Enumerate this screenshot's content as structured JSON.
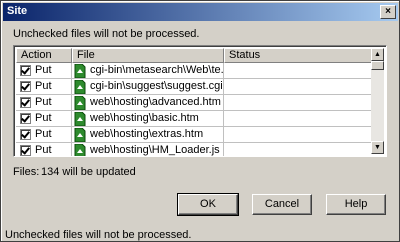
{
  "window": {
    "title": "Site",
    "close_label": "×"
  },
  "instruction": "Unchecked files will not be processed.",
  "list": {
    "columns": {
      "action": "Action",
      "file": "File",
      "status": "Status"
    },
    "rows": [
      {
        "action": "Put",
        "file": "cgi-bin\\metasearch\\Web\\te...",
        "status": ""
      },
      {
        "action": "Put",
        "file": "cgi-bin\\suggest\\suggest.cgi",
        "status": ""
      },
      {
        "action": "Put",
        "file": "web\\hosting\\advanced.htm",
        "status": ""
      },
      {
        "action": "Put",
        "file": "web\\hosting\\basic.htm",
        "status": ""
      },
      {
        "action": "Put",
        "file": "web\\hosting\\extras.htm",
        "status": ""
      },
      {
        "action": "Put",
        "file": "web\\hosting\\HM_Loader.js",
        "status": ""
      }
    ]
  },
  "summary": {
    "label": "Files:",
    "value": "134 will be updated"
  },
  "buttons": {
    "ok": "OK",
    "cancel": "Cancel",
    "help": "Help"
  },
  "status_bar": "Unchecked files will not be processed.",
  "colors": {
    "title_start": "#0a246a",
    "title_end": "#a6caf0",
    "face": "#d4d0c8",
    "icon_green": "#2e8b2e"
  }
}
